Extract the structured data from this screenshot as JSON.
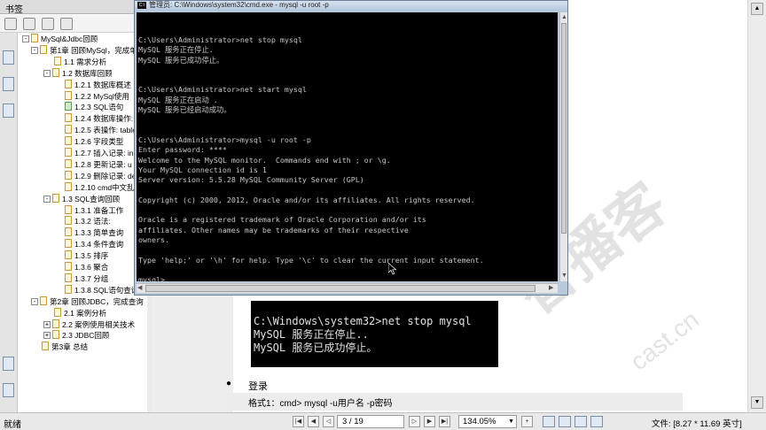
{
  "bookmark_panel": {
    "title": "书签",
    "tree": [
      {
        "label": "MySql&Jdbc回顾",
        "level": 0,
        "expander": "-",
        "icon": "folder"
      },
      {
        "label": "第1章  回顾MySql，完成单…",
        "level": 1,
        "expander": "-",
        "icon": "page"
      },
      {
        "label": "1.1 需求分析",
        "level": 2,
        "expander": "",
        "icon": "page"
      },
      {
        "label": "1.2 数据库回顾",
        "level": 2,
        "expander": "-",
        "icon": "page"
      },
      {
        "label": "1.2.1 数据库概述",
        "level": 3,
        "expander": "",
        "icon": "page"
      },
      {
        "label": "1.2.2 MySql使用",
        "level": 3,
        "expander": "",
        "icon": "page"
      },
      {
        "label": "1.2.3 SQL语句",
        "level": 3,
        "expander": "",
        "icon": "page-green"
      },
      {
        "label": "1.2.4 数据库操作:",
        "level": 3,
        "expander": "",
        "icon": "page"
      },
      {
        "label": "1.2.5 表操作: table",
        "level": 3,
        "expander": "",
        "icon": "page"
      },
      {
        "label": "1.2.6 字段类型",
        "level": 3,
        "expander": "",
        "icon": "page"
      },
      {
        "label": "1.2.7 插入记录: in",
        "level": 3,
        "expander": "",
        "icon": "page"
      },
      {
        "label": "1.2.8 更新记录: u",
        "level": 3,
        "expander": "",
        "icon": "page"
      },
      {
        "label": "1.2.9 删除记录: de",
        "level": 3,
        "expander": "",
        "icon": "page"
      },
      {
        "label": "1.2.10 cmd中文乱码",
        "level": 3,
        "expander": "",
        "icon": "page"
      },
      {
        "label": "1.3  SQL查询回顾",
        "level": 2,
        "expander": "-",
        "icon": "page"
      },
      {
        "label": "1.3.1 准备工作",
        "level": 3,
        "expander": "",
        "icon": "page"
      },
      {
        "label": "1.3.2 语法:",
        "level": 3,
        "expander": "",
        "icon": "page"
      },
      {
        "label": "1.3.3 简单查询",
        "level": 3,
        "expander": "",
        "icon": "page"
      },
      {
        "label": "1.3.4 条件查询",
        "level": 3,
        "expander": "",
        "icon": "page"
      },
      {
        "label": "1.3.5 排序",
        "level": 3,
        "expander": "",
        "icon": "page"
      },
      {
        "label": "1.3.6 聚合",
        "level": 3,
        "expander": "",
        "icon": "page"
      },
      {
        "label": "1.3.7 分组",
        "level": 3,
        "expander": "",
        "icon": "page"
      },
      {
        "label": "1.3.8 SQL语句查询",
        "level": 3,
        "expander": "",
        "icon": "page"
      },
      {
        "label": "第2章  回顾JDBC，完成查询",
        "level": 1,
        "expander": "-",
        "icon": "page"
      },
      {
        "label": "2.1 案例分析",
        "level": 2,
        "expander": "",
        "icon": "page"
      },
      {
        "label": "2.2 案例使用相关技术",
        "level": 2,
        "expander": "+",
        "icon": "page"
      },
      {
        "label": "2.3 JDBC回顾",
        "level": 2,
        "expander": "+",
        "icon": "page"
      },
      {
        "label": "第3章  总结",
        "level": 1,
        "expander": "",
        "icon": "page"
      }
    ]
  },
  "cmd_window": {
    "title": "管理员: C:\\Windows\\system32\\cmd.exe - mysql  -u root -p",
    "icon_text": "C:\\",
    "lines": [
      "C:\\Users\\Administrator>net stop mysql",
      "MySQL 服务正在停止.",
      "MySQL 服务已成功停止。",
      "",
      "",
      "C:\\Users\\Administrator>net start mysql",
      "MySQL 服务正在启动 .",
      "MySQL 服务已经启动成功。",
      "",
      "",
      "C:\\Users\\Administrator>mysql -u root -p",
      "Enter password: ****",
      "Welcome to the MySQL monitor.  Commands end with ; or \\g.",
      "Your MySQL connection id is 1",
      "Server version: 5.5.28 MySQL Community Server (GPL)",
      "",
      "Copyright (c) 2000, 2012, Oracle and/or its affiliates. All rights reserved.",
      "",
      "Oracle is a registered trademark of Oracle Corporation and/or its",
      "affiliates. Other names may be trademarks of their respective",
      "owners.",
      "",
      "Type 'help;' or '\\h' for help. Type '\\c' to clear the current input statement.",
      "",
      "mysql> _"
    ]
  },
  "document": {
    "screenshot_lines": [
      "C:\\Windows\\system32>net stop mysql",
      "MySQL 服务正在停止..",
      "MySQL 服务已成功停止。"
    ],
    "bullet": "●",
    "login_heading": "登录",
    "format_line": "格式1：cmd>  mysql -u用户名 -p密码",
    "watermark": "智播客",
    "watermark_url": "cast.cn"
  },
  "status_bar": {
    "status": "就绪",
    "page_indicator": "3 / 19",
    "zoom": "134.05%",
    "file_size": "文件: [8.27 * 11.69 英寸]"
  },
  "colors": {
    "console_bg": "#000000",
    "console_text": "#c8c8c8",
    "titlebar": "#b9c9dc"
  }
}
